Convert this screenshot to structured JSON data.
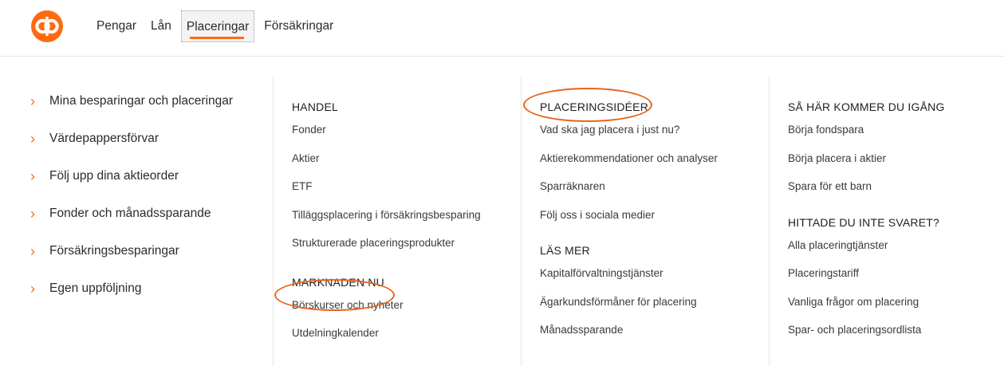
{
  "header": {
    "brand_color": "#ff6a10",
    "nav": [
      {
        "label": "Pengar",
        "active": false
      },
      {
        "label": "Lån",
        "active": false
      },
      {
        "label": "Placeringar",
        "active": true
      },
      {
        "label": "Försäkringar",
        "active": false
      }
    ]
  },
  "left_menu": [
    "Mina besparingar och placeringar",
    "Värdepappersförvar",
    "Följ upp dina aktieorder",
    "Fonder och månadssparande",
    "Försäkringsbesparingar",
    "Egen uppföljning"
  ],
  "columns": [
    {
      "sections": [
        {
          "heading": "HANDEL",
          "links": [
            "Fonder",
            "Aktier",
            "ETF",
            "Tilläggsplacering i försäkringsbesparing",
            "Strukturerade placeringsprodukter"
          ]
        },
        {
          "heading": "MARKNADEN NU",
          "links": [
            "Börskurser och nyheter",
            "Utdelningkalender"
          ]
        }
      ]
    },
    {
      "sections": [
        {
          "heading": "PLACERINGSIDÉER",
          "links": [
            "Vad ska jag placera i just nu?",
            "Aktierekommendationer och analyser",
            "Sparräknaren",
            "Följ oss i sociala medier"
          ]
        },
        {
          "heading": "LÄS MER",
          "links": [
            "Kapitalförvaltningstjänster",
            "Ägarkundsförmåner för placering",
            "Månadssparande"
          ]
        }
      ]
    },
    {
      "sections": [
        {
          "heading": "SÅ HÄR KOMMER DU IGÅNG",
          "links": [
            "Börja fondspara",
            "Börja placera i aktier",
            "Spara för ett barn"
          ]
        },
        {
          "heading": "HITTADE DU INTE SVARET?",
          "links": [
            "Alla placeringtjänster",
            "Placeringstariff",
            "Vanliga frågor om placering",
            "Spar- och placeringsordlista"
          ]
        }
      ]
    }
  ]
}
